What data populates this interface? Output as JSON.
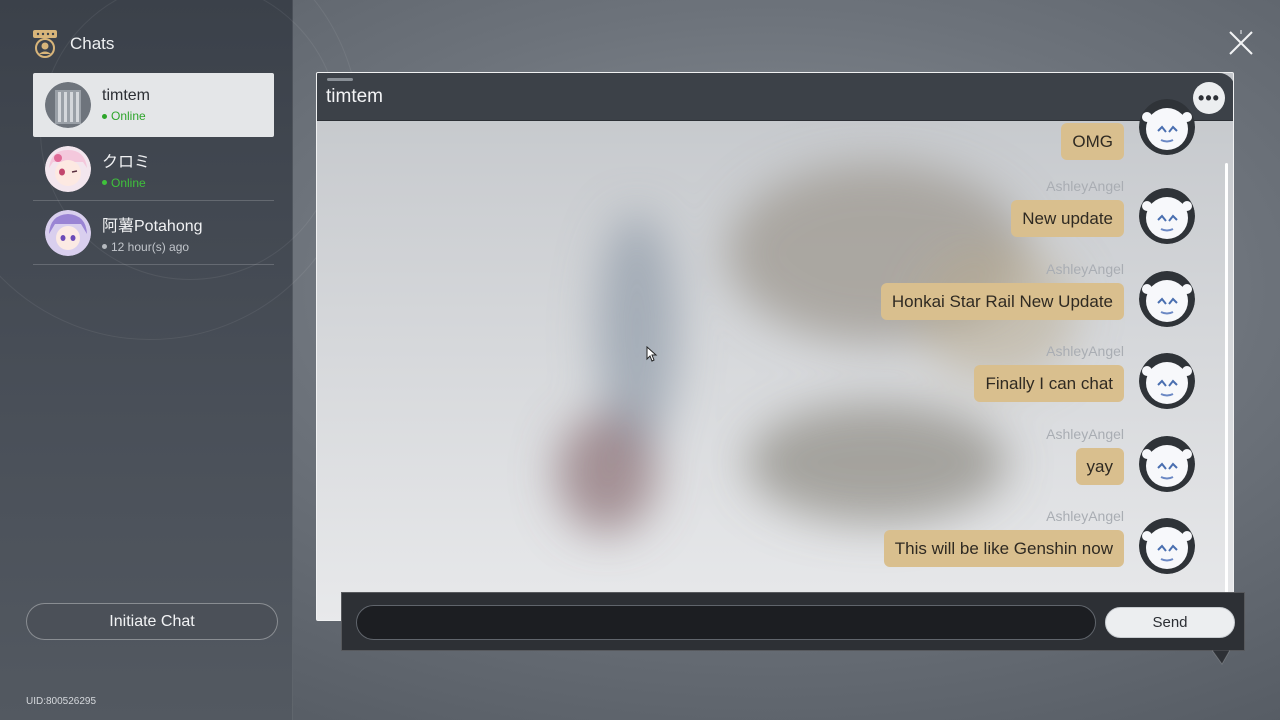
{
  "sidebar": {
    "title": "Chats",
    "icon": "chat-bubbles-icon",
    "contacts": [
      {
        "name": "timtem",
        "status": "Online",
        "status_type": "online",
        "active": true
      },
      {
        "name": "クロミ",
        "status": "Online",
        "status_type": "online",
        "active": false
      },
      {
        "name": "阿薯Potahong",
        "status": "12 hour(s) ago",
        "status_type": "offline",
        "active": false
      }
    ],
    "initiate_label": "Initiate Chat",
    "uid": "UID:800526295"
  },
  "chat": {
    "title": "timtem",
    "more_icon": "more-options-icon",
    "messages": [
      {
        "sender": "",
        "text": "OMG"
      },
      {
        "sender": "AshleyAngel",
        "text": "New update"
      },
      {
        "sender": "AshleyAngel",
        "text": "Honkai Star Rail New Update"
      },
      {
        "sender": "AshleyAngel",
        "text": "Finally I can chat"
      },
      {
        "sender": "AshleyAngel",
        "text": "yay"
      },
      {
        "sender": "AshleyAngel",
        "text": "This will be like Genshin now"
      }
    ]
  },
  "composer": {
    "value": "",
    "send_label": "Send"
  },
  "colors": {
    "bubble": "#d9bf8e",
    "online": "#3fc23b",
    "sidebar": "#3b414a",
    "header": "#3c4148"
  },
  "close_icon": "close-x-icon"
}
